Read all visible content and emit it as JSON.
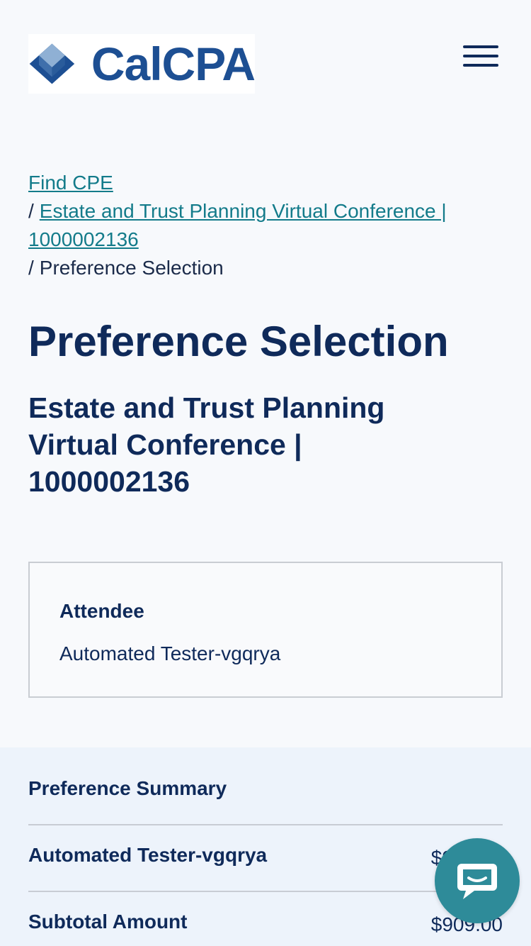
{
  "header": {
    "logo_text": "CalCPA",
    "menu_icon": "hamburger-icon"
  },
  "breadcrumb": {
    "items": [
      {
        "label": "Find CPE"
      },
      {
        "label": "Estate and Trust Planning Virtual Conference | 1000002136"
      }
    ],
    "separator": "/",
    "current": "Preference Selection"
  },
  "page_title": "Preference Selection",
  "event_title": "Estate and Trust Planning Virtual Conference | 1000002136",
  "attendee_card": {
    "label": "Attendee",
    "name": "Automated Tester-vgqrya"
  },
  "summary": {
    "title": "Preference Summary",
    "rows": [
      {
        "label": "Automated Tester-vgqrya",
        "value": "$909.00"
      },
      {
        "label": "Subtotal Amount",
        "value": "$909.00"
      }
    ]
  },
  "chat": {
    "icon": "chat-bubble-icon"
  },
  "colors": {
    "navy": "#0f2a5a",
    "link": "#137b8a",
    "brand_blue": "#1d4f93",
    "chat_teal": "#2e8b99"
  }
}
